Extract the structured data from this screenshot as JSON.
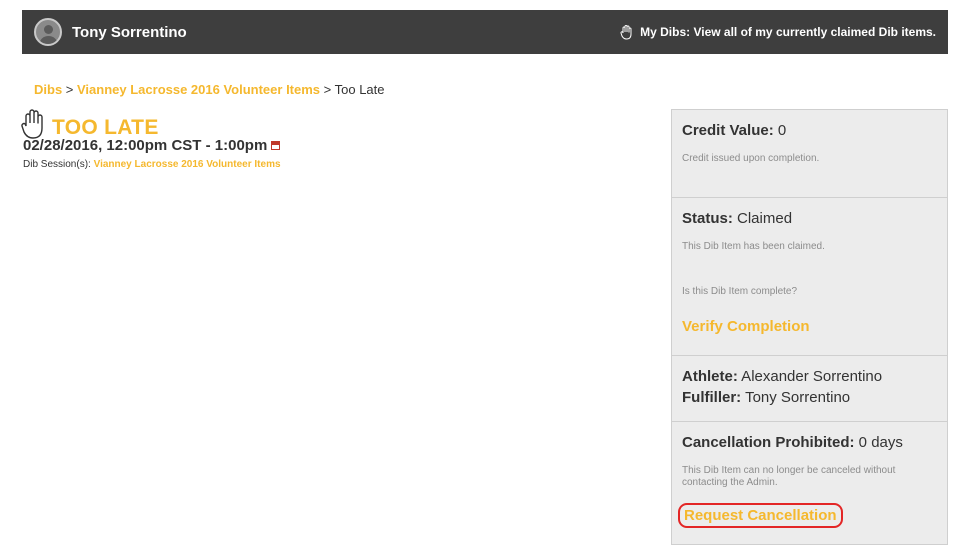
{
  "header": {
    "user_name": "Tony Sorrentino",
    "my_dibs_label": "My Dibs: View all of my currently claimed Dib items."
  },
  "breadcrumb": {
    "root": "Dibs",
    "separator1": " > ",
    "session": "Vianney Lacrosse 2016 Volunteer Items",
    "separator2": " > ",
    "current": "Too Late"
  },
  "item": {
    "title": "TOO LATE",
    "datetime": "02/28/2016, 12:00pm CST - 1:00pm",
    "session_label": "Dib Session(s): ",
    "session_link": "Vianney Lacrosse 2016 Volunteer Items"
  },
  "panel": {
    "credit_label": "Credit Value:",
    "credit_value": " 0",
    "credit_note": "Credit issued upon completion.",
    "status_label": "Status:",
    "status_value": " Claimed",
    "status_note": "This Dib Item has been claimed.",
    "complete_question": "Is this Dib Item complete?",
    "verify_label": "Verify Completion",
    "athlete_label": "Athlete:",
    "athlete_value": " Alexander Sorrentino",
    "fulfiller_label": "Fulfiller:",
    "fulfiller_value": " Tony Sorrentino",
    "cancel_label": "Cancellation Prohibited:",
    "cancel_value": " 0 days",
    "cancel_note": "This Dib Item can no longer be canceled without contacting the Admin.",
    "request_label": "Request Cancellation"
  },
  "colors": {
    "accent": "#f5b82e",
    "header_bg": "#3e3e3e",
    "highlight_border": "#e32626"
  }
}
